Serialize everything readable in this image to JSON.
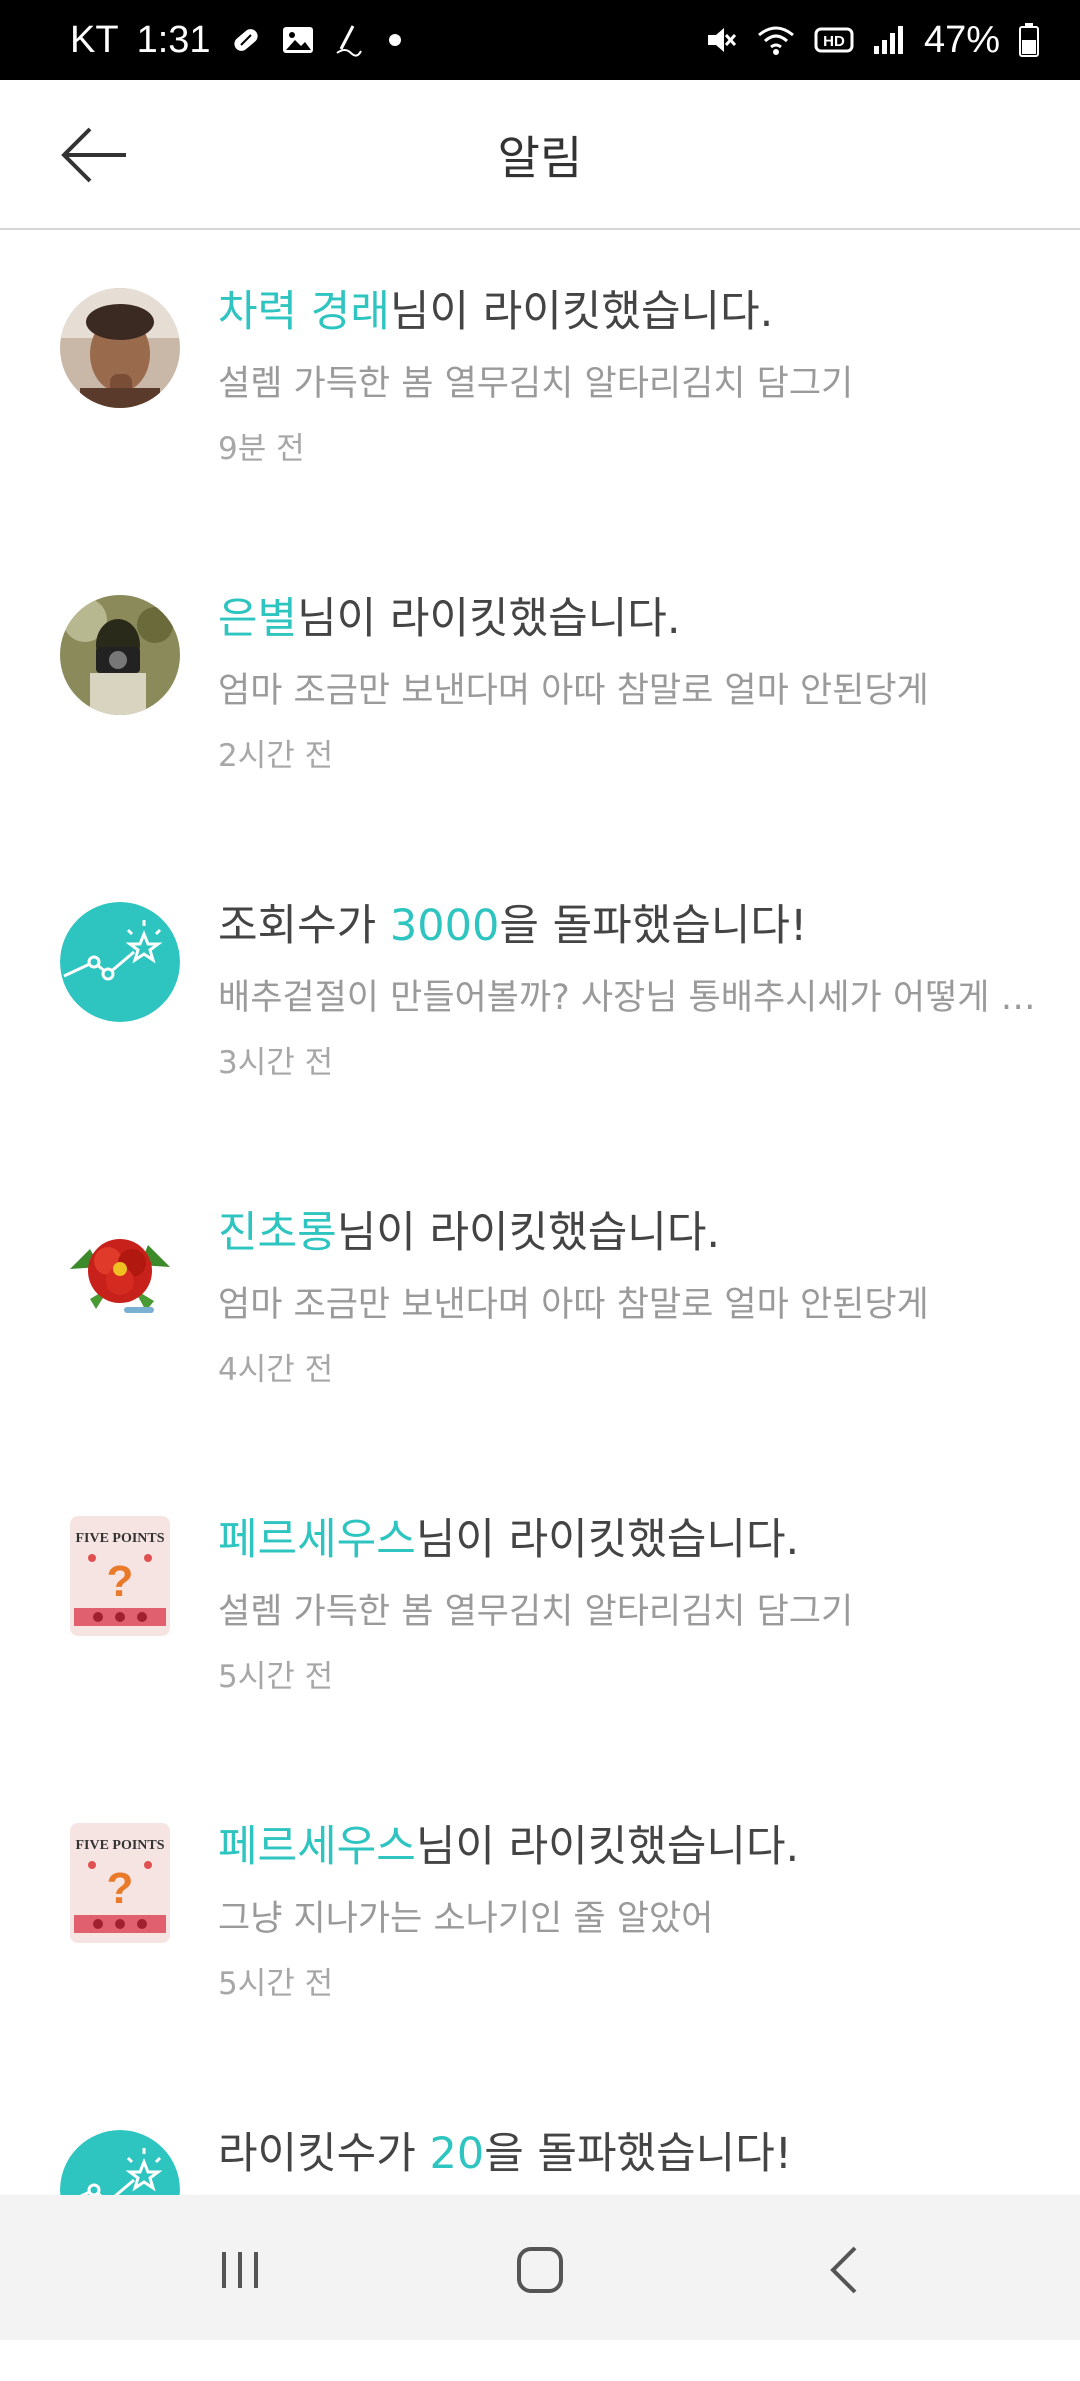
{
  "status_bar": {
    "carrier": "KT",
    "time": "1:31",
    "battery": "47%",
    "icons": [
      "pill-icon",
      "image-icon",
      "pen-icon",
      "dot-icon",
      "mute-icon",
      "wifi-icon",
      "hd-icon",
      "signal-icon",
      "battery-icon"
    ]
  },
  "header": {
    "title": "알림",
    "back_icon": "arrow-left-icon"
  },
  "notifications": [
    {
      "highlight": "차력 경래",
      "message": "님이 라이킷했습니다.",
      "subtitle": "설렘 가득한 봄 열무김치 알타리김치 담그기",
      "time": "9분 전",
      "avatar": "person-photo"
    },
    {
      "highlight": "은별",
      "message": "님이 라이킷했습니다.",
      "subtitle": "엄마 조금만 보낸다며 아따 참말로 얼마 안된당게",
      "time": "2시간 전",
      "avatar": "camera-photo"
    },
    {
      "prefix": "조회수가 ",
      "highlight": "3000",
      "message": "을 돌파했습니다!",
      "subtitle": "배추겉절이 만들어볼까? 사장님 통배추시세가 어떻게 …",
      "time": "3시간 전",
      "avatar": "stats-star-icon"
    },
    {
      "highlight": "진초롱",
      "message": "님이 라이킷했습니다.",
      "subtitle": "엄마 조금만 보낸다며 아따 참말로 얼마 안된당게",
      "time": "4시간 전",
      "avatar": "flower-image"
    },
    {
      "highlight": "페르세우스",
      "message": "님이 라이킷했습니다.",
      "subtitle": "설렘 가득한 봄 열무김치 알타리김치 담그기",
      "time": "5시간 전",
      "avatar": "five-points-book-cover",
      "avatar_text": "FIVE POINTS"
    },
    {
      "highlight": "페르세우스",
      "message": "님이 라이킷했습니다.",
      "subtitle": "그냥 지나가는 소나기인 줄 알았어",
      "time": "5시간 전",
      "avatar": "five-points-book-cover",
      "avatar_text": "FIVE POINTS"
    },
    {
      "prefix": "라이킷수가 ",
      "highlight": "20",
      "message": "을 돌파했습니다!",
      "subtitle": "",
      "time": "",
      "avatar": "stats-star-icon"
    }
  ],
  "nav_bar": {
    "buttons": [
      "recent-apps-icon",
      "home-icon",
      "back-icon"
    ]
  },
  "colors": {
    "accent": "#2ec4c0",
    "text_primary": "#444444",
    "text_secondary": "#9a9a9a",
    "status_bar_bg": "#000000",
    "nav_bar_bg": "#f3f3f3"
  }
}
